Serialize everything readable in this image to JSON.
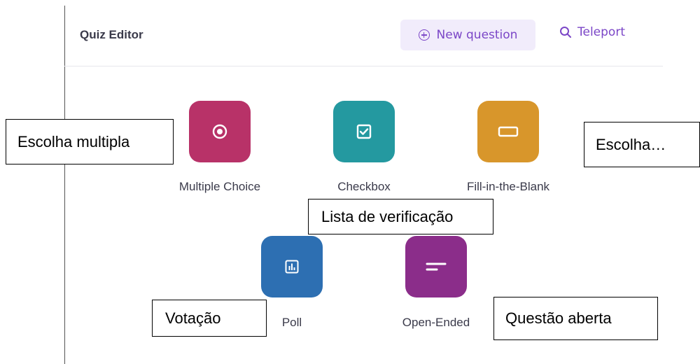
{
  "header": {
    "title": "Quiz Editor",
    "new_question_label": "New question",
    "teleport_label": "Teleport"
  },
  "tiles": [
    {
      "label": "Multiple Choice",
      "color": "#b83268",
      "icon": "radio-icon"
    },
    {
      "label": "Checkbox",
      "color": "#2499a0",
      "icon": "checkbox-icon"
    },
    {
      "label": "Fill-in-the-Blank",
      "color": "#d8962b",
      "icon": "blank-field-icon"
    },
    {
      "label": "Poll",
      "color": "#2d6fb2",
      "icon": "bar-chart-icon"
    },
    {
      "label": "Open-Ended",
      "color": "#8b2d8a",
      "icon": "text-lines-icon"
    }
  ],
  "callouts": {
    "multiple_choice": "Escolha multipla",
    "fill_blank": "Escolha…",
    "checkbox": "Lista de verificação",
    "poll": "Votação",
    "open_ended": "Questão aberta"
  },
  "colors": {
    "accent": "#7b46c7",
    "accent_bg": "#f1ecfb"
  }
}
